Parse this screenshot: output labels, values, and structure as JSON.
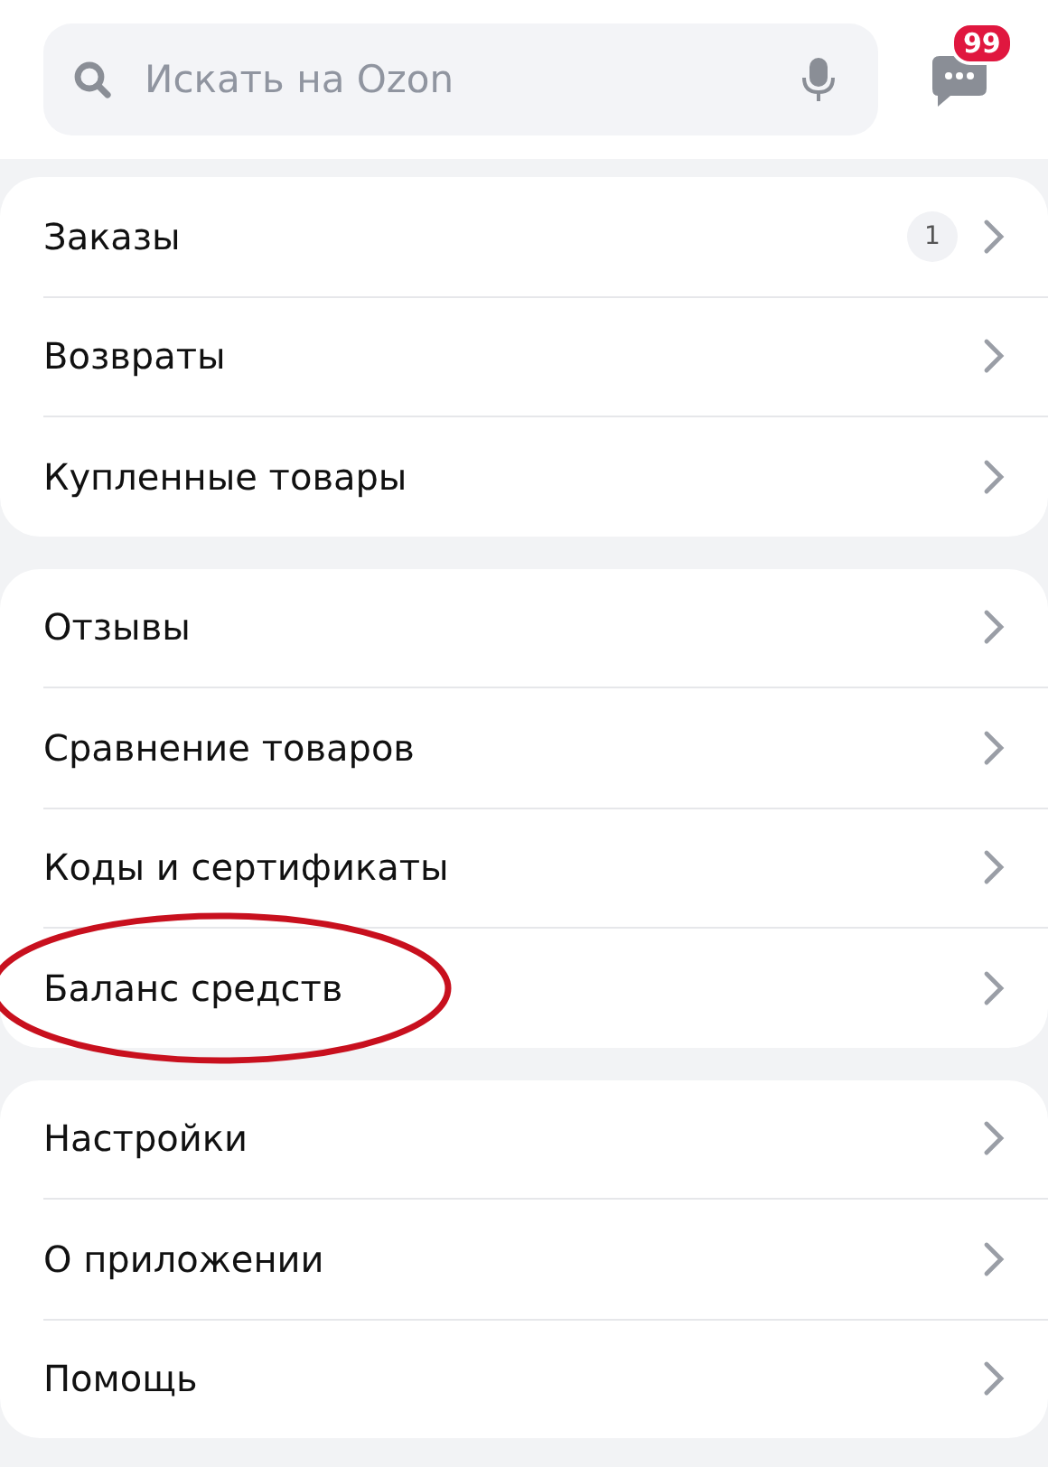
{
  "search": {
    "placeholder": "Искать на Ozon"
  },
  "chat": {
    "badge": "99"
  },
  "groups": [
    {
      "items": [
        {
          "label": "Заказы",
          "count": "1",
          "circled": false
        },
        {
          "label": "Возвраты",
          "circled": false
        },
        {
          "label": "Купленные товары",
          "circled": false
        }
      ]
    },
    {
      "items": [
        {
          "label": "Отзывы",
          "circled": false
        },
        {
          "label": "Сравнение товаров",
          "circled": false
        },
        {
          "label": "Коды и сертификаты",
          "circled": false
        },
        {
          "label": "Баланс средств",
          "circled": true
        }
      ]
    },
    {
      "items": [
        {
          "label": "Настройки",
          "circled": false
        },
        {
          "label": "О приложении",
          "circled": false
        },
        {
          "label": "Помощь",
          "circled": false
        }
      ]
    }
  ]
}
